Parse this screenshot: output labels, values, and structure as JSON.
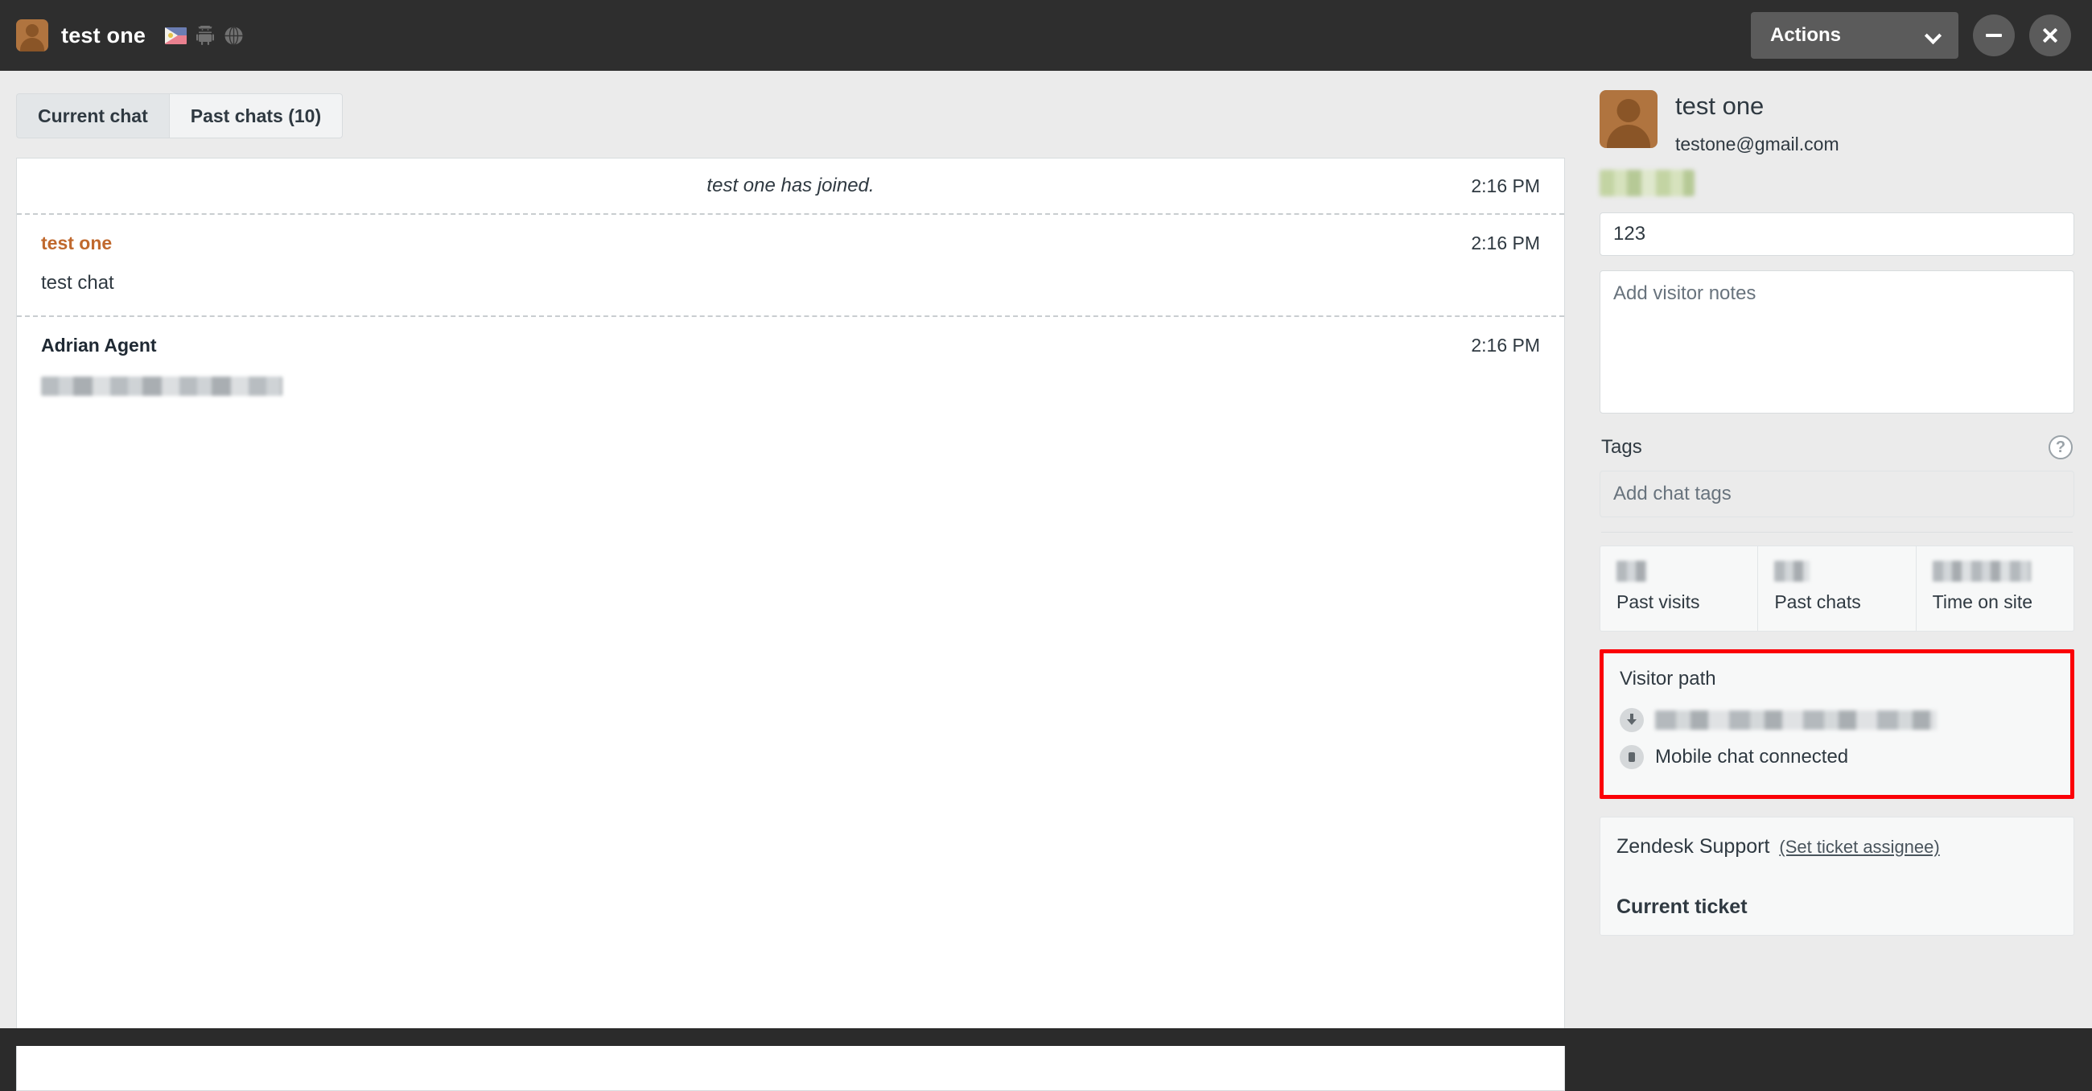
{
  "titlebar": {
    "visitor_name": "test one",
    "avatar_icon": "person-avatar-icon",
    "flag_icon": "philippines-flag-icon",
    "device_icon": "android-robot-icon",
    "browser_icon": "globe-browser-icon",
    "actions_label": "Actions",
    "chevron_icon": "chevron-down-icon",
    "minimize_icon": "minimize-icon",
    "close_icon": "close-icon"
  },
  "tabs": [
    {
      "label": "Current chat",
      "active": true
    },
    {
      "label": "Past chats (10)",
      "active": false
    }
  ],
  "transcript": {
    "system_message": "test one has joined.",
    "system_time": "2:16 PM",
    "messages": [
      {
        "author": "test one",
        "time": "2:16 PM",
        "text": "test chat",
        "role": "visitor"
      },
      {
        "author": "Adrian Agent",
        "time": "2:16 PM",
        "text": "",
        "role": "agent",
        "redacted": true
      }
    ]
  },
  "sidebar": {
    "visitor_name": "test one",
    "visitor_email": "testone@gmail.com",
    "badge_redacted": true,
    "phone_value": "123",
    "notes_placeholder": "Add visitor notes",
    "tags": {
      "label": "Tags",
      "help_icon": "question-mark-icon",
      "input_placeholder": "Add chat tags"
    },
    "stats": [
      {
        "label": "Past visits",
        "value_redacted": true
      },
      {
        "label": "Past chats",
        "value_redacted": true
      },
      {
        "label": "Time on site",
        "value_redacted": true
      }
    ],
    "visitor_path": {
      "title": "Visitor path",
      "highlight_color": "#fb0007",
      "entries": [
        {
          "icon": "download-arrow-icon",
          "text": "",
          "redacted": true
        },
        {
          "icon": "dot-marker-icon",
          "text": "Mobile chat connected",
          "redacted": false
        }
      ]
    },
    "zendesk": {
      "title": "Zendesk Support",
      "link": "(Set ticket assignee)",
      "subtitle": "Current ticket"
    }
  }
}
